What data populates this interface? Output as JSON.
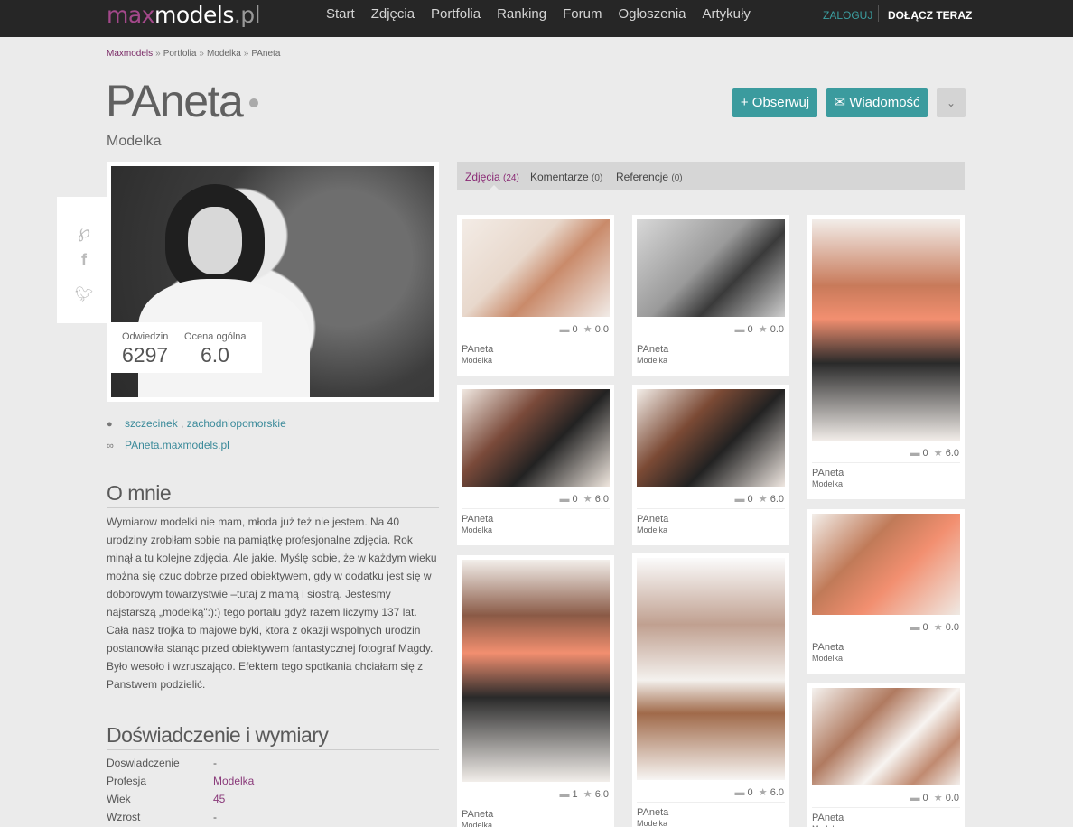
{
  "topbar": {
    "logo_max": "max",
    "logo_models": "models",
    "logo_pl": ".pl",
    "nav": [
      "Start",
      "Zdjęcia",
      "Portfolia",
      "Ranking",
      "Forum",
      "Ogłoszenia",
      "Artykuły"
    ],
    "login": "ZALOGUJ",
    "join": "DOŁĄCZ TERAZ"
  },
  "breadcrumb": [
    "Maxmodels",
    "Portfolia",
    "Modelka",
    "PAneta"
  ],
  "breadcrumb_sep": "»",
  "profile": {
    "name": "PAneta",
    "role": "Modelka",
    "follow_label": "+ Obserwuj",
    "message_label": "✉ Wiadomość",
    "more_icon": "chevron-down-icon",
    "visits_label": "Odwiedzin",
    "visits": "6297",
    "rating_label": "Ocena ogólna",
    "rating": "6.0",
    "city": "szczecinek",
    "region": "zachodniopomorskie",
    "website": "PAneta.maxmodels.pl"
  },
  "share_icons": [
    "pinterest-icon",
    "facebook-icon",
    "twitter-icon"
  ],
  "about": {
    "title": "O mnie",
    "text": "Wymiarow modelki nie mam, młoda już też nie jestem. Na 40 urodziny zrobiłam sobie na pamiątkę profesjonalne zdjęcia. Rok minął a tu kolejne zdjęcia. Ale jakie. Myślę sobie, że w każdym wieku można się czuc dobrze przed obiektywem, gdy w dodatku jest się w doborowym towarzystwie –tutaj z mamą i siostrą. Jestesmy najstarszą „modelką\":):) tego portalu gdyż razem liczymy 137 lat. Cała nasz trojka to majowe byki, ktora z okazji wspolnych urodzin postanowiła stanąc przed obiektywem fantastycznej fotograf Magdy. Było wesoło i wzruszająco. Efektem tego spotkania chciałam się z Panstwem podzielić."
  },
  "experience": {
    "title": "Doświadczenie i wymiary",
    "rows": [
      {
        "k": "Doswiadczenie",
        "v": "-"
      },
      {
        "k": "Profesja",
        "v": "Modelka"
      },
      {
        "k": "Wiek",
        "v": "45"
      },
      {
        "k": "Wzrost",
        "v": "-"
      }
    ]
  },
  "tabs": [
    {
      "label": "Zdjęcia",
      "count": "(24)"
    },
    {
      "label": "Komentarze",
      "count": "(0)"
    },
    {
      "label": "Referencje",
      "count": "(0)"
    }
  ],
  "photos": [
    {
      "comments": "0",
      "rating": "0.0",
      "author": "PAneta",
      "role": "Modelka"
    },
    {
      "comments": "0",
      "rating": "0.0",
      "author": "PAneta",
      "role": "Modelka"
    },
    {
      "comments": "0",
      "rating": "6.0",
      "author": "PAneta",
      "role": "Modelka"
    },
    {
      "comments": "0",
      "rating": "6.0",
      "author": "PAneta",
      "role": "Modelka"
    },
    {
      "comments": "0",
      "rating": "6.0",
      "author": "PAneta",
      "role": "Modelka"
    },
    {
      "comments": "0",
      "rating": "0.0",
      "author": "PAneta",
      "role": "Modelka"
    },
    {
      "comments": "1",
      "rating": "6.0",
      "author": "PAneta",
      "role": "Modelka"
    },
    {
      "comments": "0",
      "rating": "6.0",
      "author": "PAneta",
      "role": "Modelka"
    },
    {
      "comments": "0",
      "rating": "0.0",
      "author": "PAneta",
      "role": "Modelka"
    }
  ],
  "colors": {
    "accent_teal": "#3b9b9e",
    "brand_purple": "#a3488a",
    "topbar": "#262626",
    "background": "#ebebeb"
  }
}
